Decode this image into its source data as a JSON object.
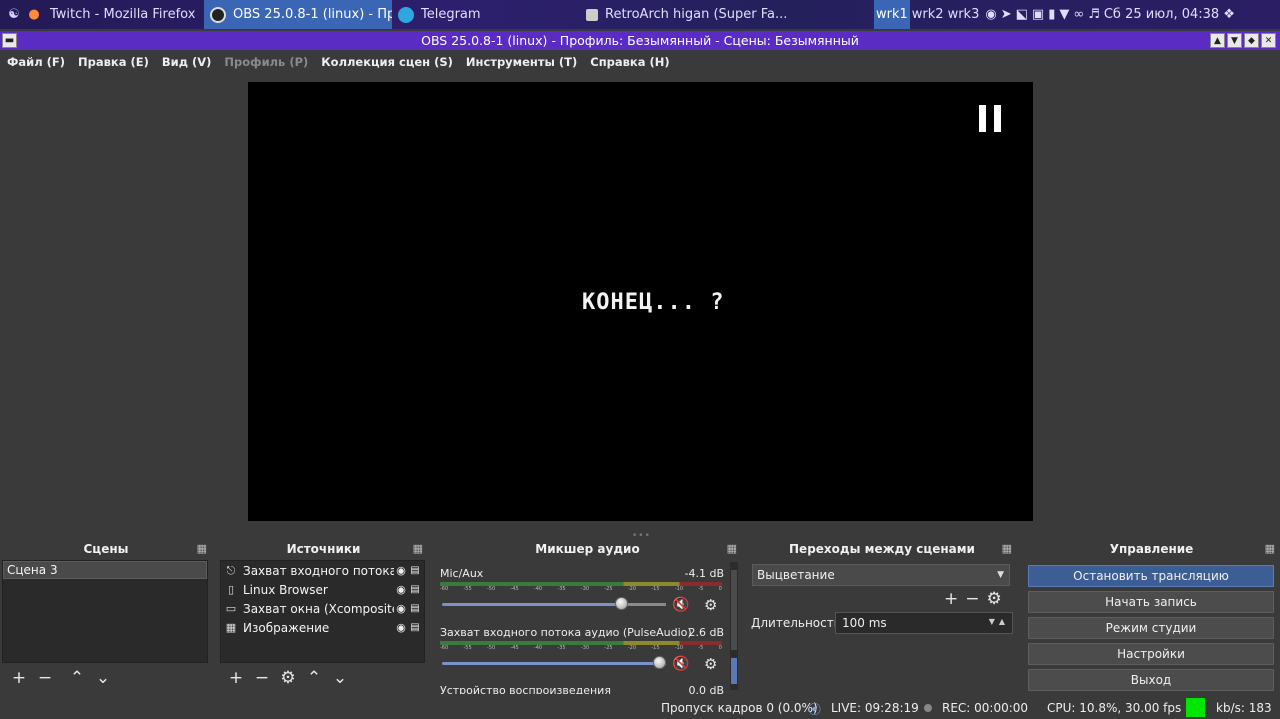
{
  "taskbar": {
    "tasks": [
      {
        "label": "Twitch - Mozilla Firefox",
        "active": false
      },
      {
        "label": "OBS 25.0.8-1 (linux) - Про...",
        "active": true
      },
      {
        "label": "Telegram",
        "active": false
      },
      {
        "label": "RetroArch higan (Super Fa...",
        "active": false
      }
    ],
    "workspaces": [
      "wrk1",
      "wrk2",
      "wrk3"
    ],
    "clock": "Сб 25 июл, 04:38"
  },
  "window": {
    "title": "OBS 25.0.8-1 (linux) - Профиль: Безымянный - Сцены: Безымянный"
  },
  "menu": {
    "items": [
      {
        "label": "Файл (F)",
        "disabled": false
      },
      {
        "label": "Правка (E)",
        "disabled": false
      },
      {
        "label": "Вид (V)",
        "disabled": false
      },
      {
        "label": "Профиль (P)",
        "disabled": true
      },
      {
        "label": "Коллекция сцен (S)",
        "disabled": false
      },
      {
        "label": "Инструменты (T)",
        "disabled": false
      },
      {
        "label": "Справка (H)",
        "disabled": false
      }
    ]
  },
  "preview": {
    "text": "КОНЕЦ... ?"
  },
  "scenes": {
    "title": "Сцены",
    "items": [
      "Сцена 3"
    ]
  },
  "sources": {
    "title": "Источники",
    "items": [
      {
        "label": "Захват входного потока ау",
        "icon": "microphone-icon"
      },
      {
        "label": "Linux Browser",
        "icon": "document-icon"
      },
      {
        "label": "Захват окна (Xcomposite)",
        "icon": "window-icon"
      },
      {
        "label": "Изображение",
        "icon": "image-icon"
      }
    ]
  },
  "mixer": {
    "title": "Микшер аудио",
    "channels": [
      {
        "name": "Mic/Aux",
        "db": "-4.1 dB",
        "level": 0.8
      },
      {
        "name": "Захват входного потока аудио (PulseAudio)",
        "db": "2.6 dB",
        "level": 0.97
      },
      {
        "name": "Устройство воспроизведения",
        "db": "0.0 dB",
        "level": 0.9
      }
    ],
    "ticks": [
      "-60",
      "-55",
      "-50",
      "-45",
      "-40",
      "-35",
      "-30",
      "-25",
      "-20",
      "-15",
      "-10",
      "-5",
      "0"
    ]
  },
  "transitions": {
    "title": "Переходы между сценами",
    "selected": "Выцветание",
    "duration_label": "Длительность",
    "duration_value": "100 ms"
  },
  "controls": {
    "title": "Управление",
    "buttons": [
      "Остановить трансляцию",
      "Начать запись",
      "Режим студии",
      "Настройки",
      "Выход"
    ]
  },
  "status": {
    "dropped": "Пропуск кадров 0 (0.0%)",
    "live": "LIVE: 09:28:19",
    "rec": "REC: 00:00:00",
    "cpu": "CPU: 10.8%, 30.00 fps",
    "kbs": "kb/s: 183",
    "indicator_color": "#00e600"
  },
  "colors": {
    "titlebar": "#5b2cc4",
    "active_task": "#3a66b5",
    "accent_button": "#3c5e95"
  }
}
